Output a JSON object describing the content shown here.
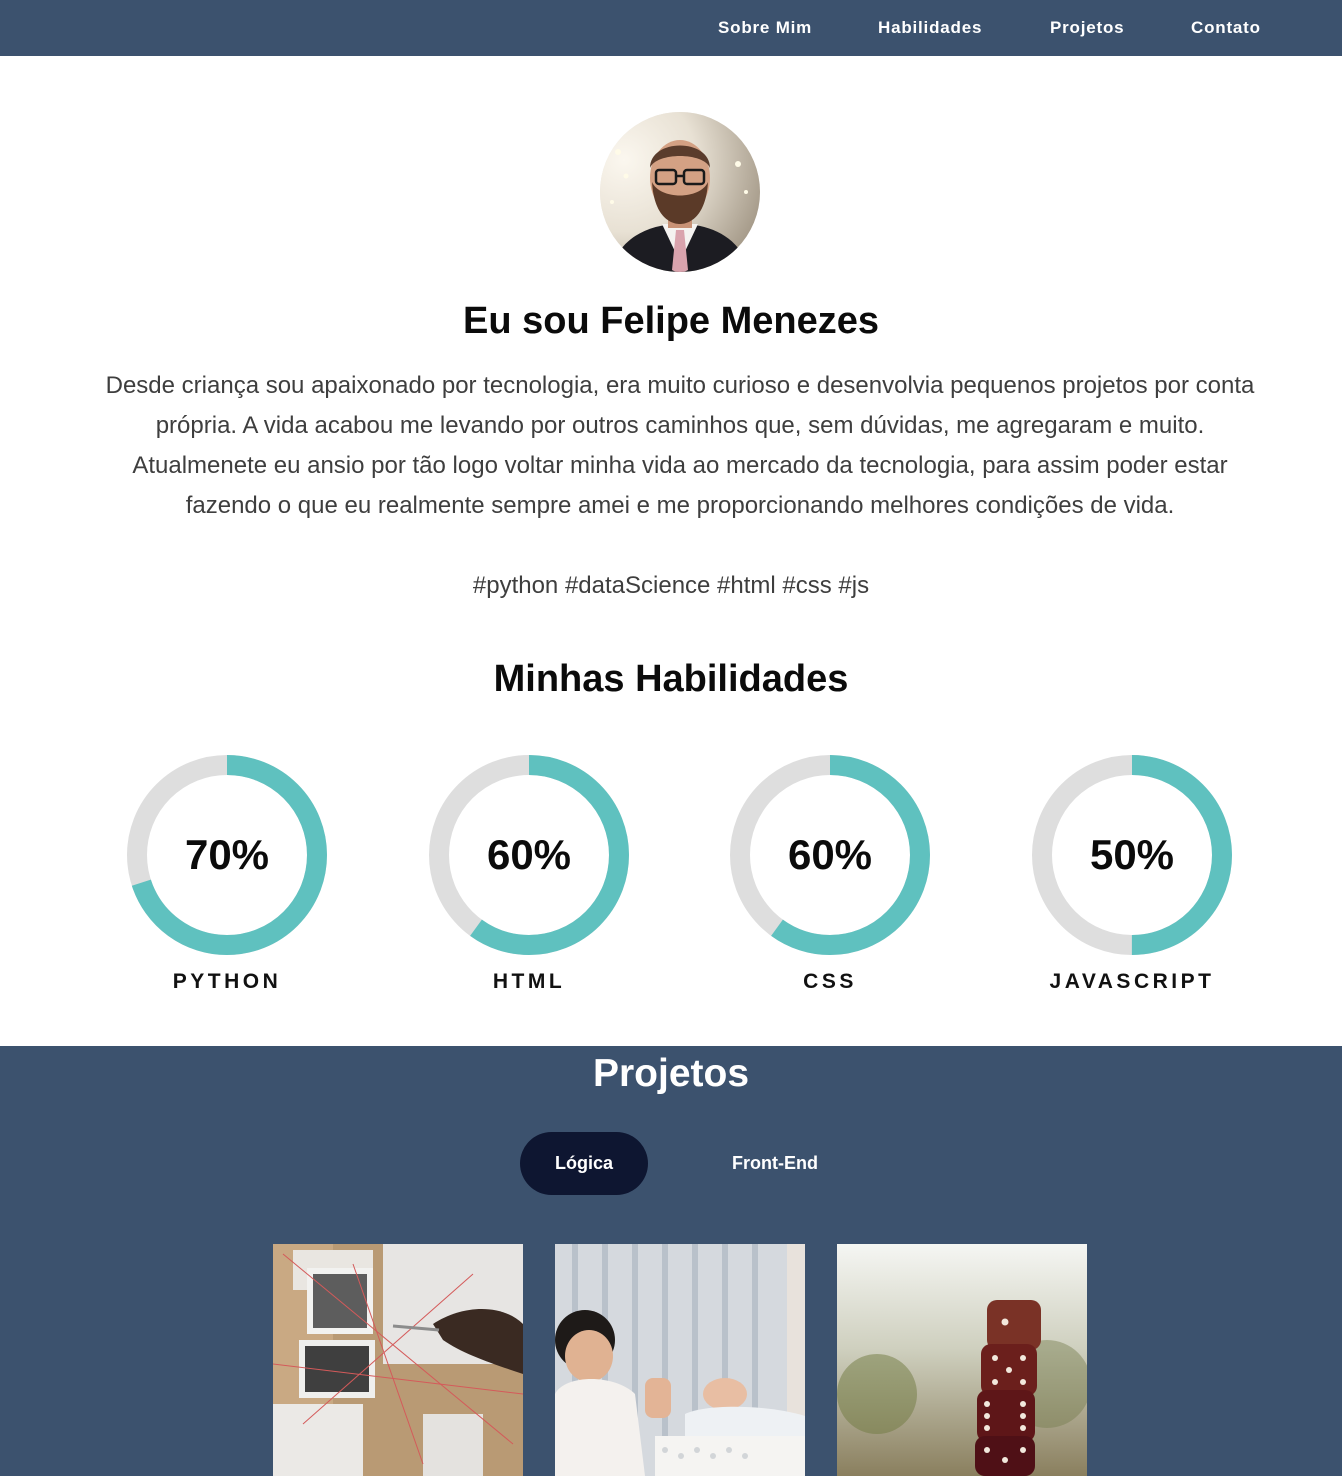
{
  "nav": {
    "items": [
      {
        "label": "Sobre Mim"
      },
      {
        "label": "Habilidades"
      },
      {
        "label": "Projetos"
      },
      {
        "label": "Contato"
      }
    ]
  },
  "hero": {
    "title": "Eu sou Felipe Menezes",
    "bio": "Desde criança sou apaixonado por tecnologia, era muito curioso e desenvolvia pequenos projetos por conta própria. A vida acabou me levando por outros caminhos que, sem dúvidas, me agregaram e muito. Atualmenete eu ansio por tão logo voltar minha vida ao mercado da tecnologia, para assim poder estar fazendo o que eu realmente sempre amei e me proporcionando melhores condições de vida.",
    "tags": "#python #dataScience #html #css #js"
  },
  "skills": {
    "title": "Minhas Habilidades",
    "ring_color": "#5fc1bf",
    "track_color": "#dedede",
    "items": [
      {
        "name": "PYTHON",
        "percent_label": "70%",
        "level": 0.7
      },
      {
        "name": "HTML",
        "percent_label": "60%",
        "level": 0.6
      },
      {
        "name": "CSS",
        "percent_label": "60%",
        "level": 0.6
      },
      {
        "name": "JAVASCRIPT",
        "percent_label": "50%",
        "level": 0.5
      }
    ]
  },
  "projects": {
    "title": "Projetos",
    "tabs": [
      {
        "label": "Lógica",
        "active": true
      },
      {
        "label": "Front-End",
        "active": false
      }
    ],
    "cards": [
      {
        "image": "investigation-board-photo"
      },
      {
        "image": "rock-paper-scissors-photo"
      },
      {
        "image": "stacked-dice-photo"
      }
    ]
  },
  "colors": {
    "nav_bg": "#3c526e",
    "section_bg": "#3c526e",
    "active_tab": "#0e1631",
    "accent": "#5fc1bf"
  }
}
